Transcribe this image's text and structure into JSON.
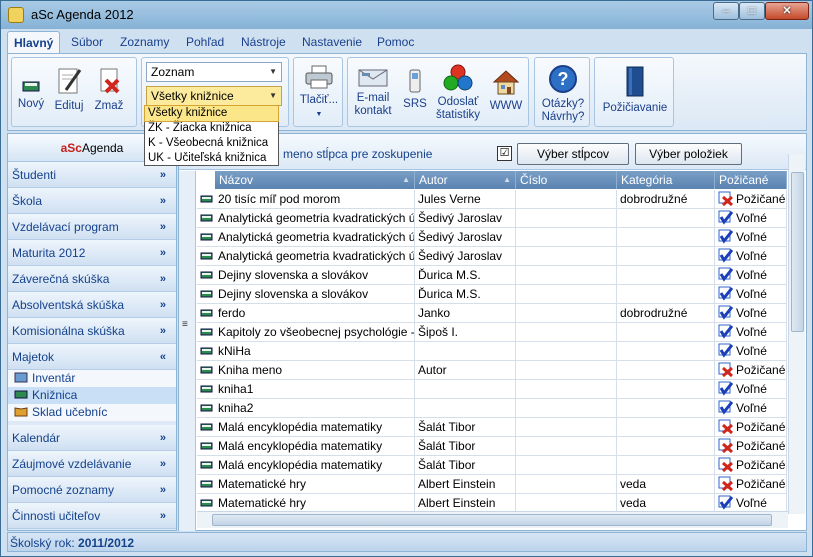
{
  "window": {
    "title": "aSc Agenda 2012"
  },
  "menu": {
    "tabs": [
      "Hlavný",
      "Súbor",
      "Zoznamy",
      "Pohľad",
      "Nástroje",
      "Nastavenie",
      "Pomoc"
    ]
  },
  "ribbon": {
    "novy": "Nový",
    "edituj": "Edituj",
    "zmaz": "Zmaž",
    "view_combo": "Zoznam",
    "filter_combo": "Všetky knižnice",
    "tlacit": "Tlačiť...",
    "email_line1": "E-mail",
    "email_line2": "kontakt",
    "srs": "SRS",
    "odoslat_line1": "Odoslať",
    "odoslat_line2": "štatistiky",
    "www": "WWW",
    "otazky_line1": "Otázky?",
    "otazky_line2": "Návrhy?",
    "pozicavanie": "Požičiavanie"
  },
  "dropdown": {
    "options": [
      "Všetky knižnice",
      "ŽK - Žiacka knižnica",
      "K - Všeobecná knižnica",
      "UK - Učiteľská knižnica"
    ],
    "selected_index": 0
  },
  "sidebar": {
    "header_a": "aSc",
    "header_b": "Agenda",
    "items": [
      "Študenti",
      "Škola",
      "Vzdelávací program",
      "Maturita 2012",
      "Záverečná skúška",
      "Absolventská skúška",
      "Komisionálna skúška",
      "Majetok"
    ],
    "subitems": [
      "Inventár",
      "Knižnica",
      "Sklad učebníc"
    ],
    "items_after": [
      "Kalendár",
      "Záujmové vzdelávanie",
      "Pomocné zoznamy",
      "Činnosti učiteľov"
    ]
  },
  "grid": {
    "group_hint": "meno stĺpca pre zoskupenie",
    "check_mark": "☑",
    "btn_columns": "Výber stĺpcov",
    "btn_items": "Výber položiek",
    "columns": [
      "Názov",
      "Autor",
      "Číslo",
      "Kategória",
      "Požičané"
    ],
    "rows": [
      [
        "20 tisíc míľ pod morom",
        "Jules Verne",
        "",
        "dobrodružné",
        "Požičané"
      ],
      [
        "Analytická geometria kvadratických ú...",
        "Šedivý Jaroslav",
        "",
        "",
        "Voľné"
      ],
      [
        "Analytická geometria kvadratických ú...",
        "Šedivý Jaroslav",
        "",
        "",
        "Voľné"
      ],
      [
        "Analytická geometria kvadratických ú...",
        "Šedivý Jaroslav",
        "",
        "",
        "Voľné"
      ],
      [
        "Dejiny slovenska a slovákov",
        "Ďurica M.S.",
        "",
        "",
        "Voľné"
      ],
      [
        "Dejiny slovenska a slovákov",
        "Ďurica M.S.",
        "",
        "",
        "Voľné"
      ],
      [
        "ferdo",
        "Janko",
        "",
        "dobrodružné",
        "Voľné"
      ],
      [
        "Kapitoly zo všeobecnej psychológie -...",
        "Šipoš I.",
        "",
        "",
        "Voľné"
      ],
      [
        "kNiHa",
        "",
        "",
        "",
        "Voľné"
      ],
      [
        "Kniha meno",
        "Autor",
        "",
        "",
        "Požičané"
      ],
      [
        "kniha1",
        "",
        "",
        "",
        "Voľné"
      ],
      [
        "kniha2",
        "",
        "",
        "",
        "Voľné"
      ],
      [
        "Malá encyklopédia matematiky",
        "Šalát Tibor",
        "",
        "",
        "Požičané"
      ],
      [
        "Malá encyklopédia matematiky",
        "Šalát Tibor",
        "",
        "",
        "Požičané"
      ],
      [
        "Malá encyklopédia matematiky",
        "Šalát Tibor",
        "",
        "",
        "Požičané"
      ],
      [
        "Matematické hry",
        "Albert Einstein",
        "",
        "veda",
        "Požičané"
      ],
      [
        "Matematické hry",
        "Albert Einstein",
        "",
        "veda",
        "Voľné"
      ]
    ]
  },
  "status": {
    "label": "Školský rok:",
    "value": "2011/2012"
  },
  "colors": {
    "accent": "#15428b",
    "brand_red": "#c8201a",
    "header_blue": "#5b83b1"
  }
}
